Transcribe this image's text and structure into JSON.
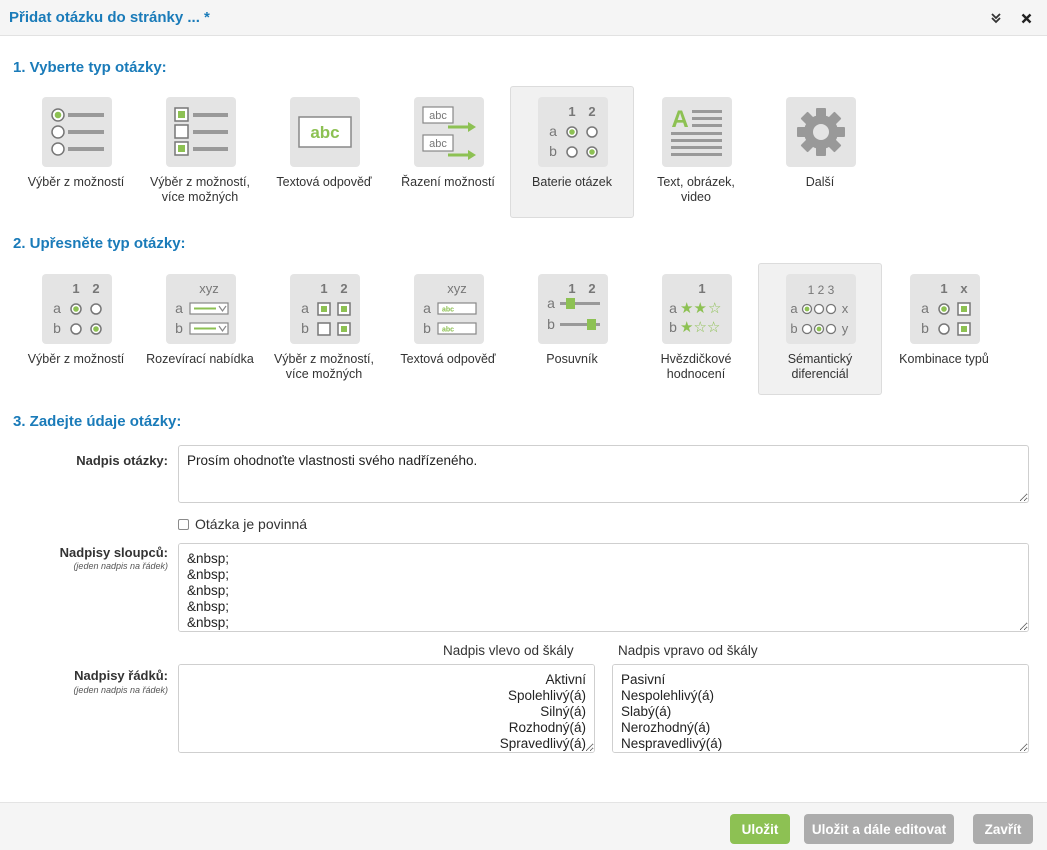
{
  "window": {
    "title": "Přidat otázku do stránky ... *"
  },
  "colors": {
    "title_blue": "#1a7bb9",
    "accent_green": "#8dc153",
    "button_gray": "#acacac"
  },
  "step1": {
    "title": "1. Vyberte typ otázky:",
    "selected": "Baterie otázek",
    "types": [
      {
        "label": "Výběr z možností",
        "icon": "radio-list-icon"
      },
      {
        "label": "Výběr z možností,\nvíce možných",
        "icon": "checkbox-list-icon"
      },
      {
        "label": "Textová odpověď",
        "icon": "text-answer-icon"
      },
      {
        "label": "Řazení možností",
        "icon": "ordering-icon"
      },
      {
        "label": "Baterie otázek",
        "icon": "matrix-icon"
      },
      {
        "label": "Text, obrázek,\nvideo",
        "icon": "text-image-video-icon"
      },
      {
        "label": "Další",
        "icon": "gear-icon"
      }
    ]
  },
  "step2": {
    "title": "2. Upřesněte typ otázky:",
    "selected": "Sémantický diferenciál",
    "types": [
      {
        "label": "Výběr z možností",
        "icon": "matrix-radio-icon"
      },
      {
        "label": "Rozevírací nabídka",
        "icon": "matrix-dropdown-icon"
      },
      {
        "label": "Výběr z možností,\nvíce možných",
        "icon": "matrix-checkbox-icon"
      },
      {
        "label": "Textová odpověď",
        "icon": "matrix-text-icon"
      },
      {
        "label": "Posuvník",
        "icon": "matrix-slider-icon"
      },
      {
        "label": "Hvězdičkové\nhodnocení",
        "icon": "star-rating-icon"
      },
      {
        "label": "Sémantický\ndiferenciál",
        "icon": "semantic-differential-icon"
      },
      {
        "label": "Kombinace typů",
        "icon": "matrix-combination-icon"
      }
    ],
    "icon_text": {
      "col1": "1",
      "col2": "2",
      "row_a": "a",
      "row_b": "b",
      "xyz": "xyz",
      "abc": "abc",
      "x": "x",
      "y": "y",
      "scale": "1 2 3"
    }
  },
  "step3": {
    "title": "3. Zadejte údaje otázky:",
    "question_label": "Nadpis otázky:",
    "question_value": "Prosím ohodnoťte vlastnosti svého nadřízeného.",
    "required_label": "Otázka je povinná",
    "columns_label": "Nadpisy sloupců:",
    "columns_hint": "(jeden nadpis na řádek)",
    "columns_value": "&nbsp;\n&nbsp;\n&nbsp;\n&nbsp;\n&nbsp;",
    "rows_label": "Nadpisy řádků:",
    "rows_hint": "(jeden nadpis na řádek)",
    "left_scale_label": "Nadpis vlevo od škály",
    "right_scale_label": "Nadpis vpravo od škály",
    "left_scale_value": "Aktivní\nSpolehlivý(á)\nSilný(á)\nRozhodný(á)\nSpravedlivý(á)",
    "right_scale_value": "Pasivní\nNespolehlivý(á)\nSlabý(á)\nNerozhodný(á)\nNespravedlivý(á)"
  },
  "footer": {
    "save": "Uložit",
    "save_continue": "Uložit a dále editovat",
    "close": "Zavřít"
  }
}
